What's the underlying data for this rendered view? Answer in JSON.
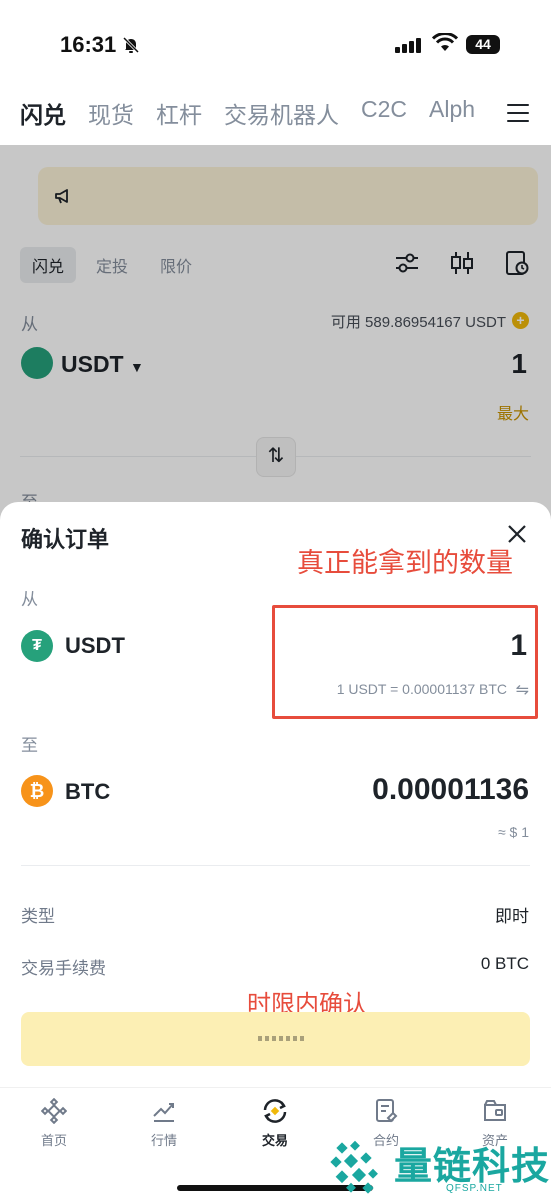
{
  "status_bar": {
    "time": "16:31",
    "battery": "44"
  },
  "top_nav": {
    "tabs": [
      "闪兑",
      "现货",
      "杠杆",
      "交易机器人",
      "C2C",
      "Alph"
    ]
  },
  "swap_form": {
    "sub_tabs": [
      "闪兑",
      "定投",
      "限价"
    ],
    "from_label": "从",
    "available": "可用 589.86954167 USDT",
    "from_coin": "USDT",
    "from_amount": "1",
    "max_label": "最大",
    "to_label": "至"
  },
  "confirm_sheet": {
    "title": "确认订单",
    "annotation_top": "真正能拿到的数量",
    "from_label": "从",
    "from_coin": "USDT",
    "from_amount": "1",
    "rate": "1 USDT = 0.00001137 BTC",
    "to_label": "至",
    "to_coin": "BTC",
    "to_amount": "0.00001136",
    "usd_value": "≈ $ 1",
    "rows": [
      {
        "label": "类型",
        "value": "即时"
      },
      {
        "label": "交易手续费",
        "value": "0 BTC"
      }
    ],
    "annotation_bottom": "时限内确认"
  },
  "bottom_tabs": [
    "首页",
    "行情",
    "交易",
    "合约",
    "资产"
  ],
  "watermark": {
    "name": "量链科技",
    "url": "QFSP.NET"
  },
  "colors": {
    "accent": "#f0b90b",
    "usdt": "#26a17b",
    "btc": "#f7931a",
    "annotation": "#e74c3c",
    "watermark": "#1aa7a0"
  }
}
